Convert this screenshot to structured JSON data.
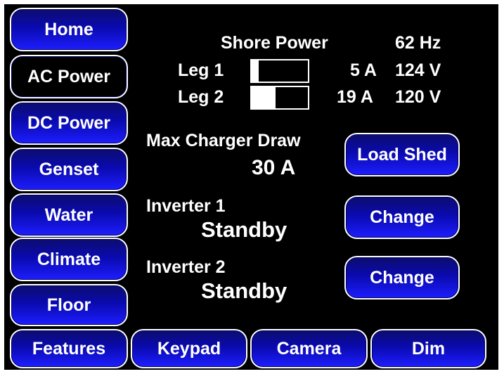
{
  "nav": {
    "home": "Home",
    "ac_power": "AC Power",
    "dc_power": "DC Power",
    "genset": "Genset",
    "water": "Water",
    "climate": "Climate",
    "floor": "Floor",
    "features": "Features"
  },
  "bottom_bar": {
    "keypad": "Keypad",
    "camera": "Camera",
    "dim": "Dim"
  },
  "shore_power": {
    "title": "Shore Power",
    "frequency": "62 Hz",
    "leg1": {
      "label": "Leg 1",
      "current": "5 A",
      "voltage": "124 V",
      "level": 0.12
    },
    "leg2": {
      "label": "Leg 2",
      "current": "19 A",
      "voltage": "120 V",
      "level": 0.42
    }
  },
  "charger": {
    "label": "Max Charger Draw",
    "value": "30 A",
    "load_shed_label": "Load Shed"
  },
  "inverter1": {
    "label": "Inverter 1",
    "status": "Standby",
    "change_label": "Change"
  },
  "inverter2": {
    "label": "Inverter 2",
    "status": "Standby",
    "change_label": "Change"
  }
}
